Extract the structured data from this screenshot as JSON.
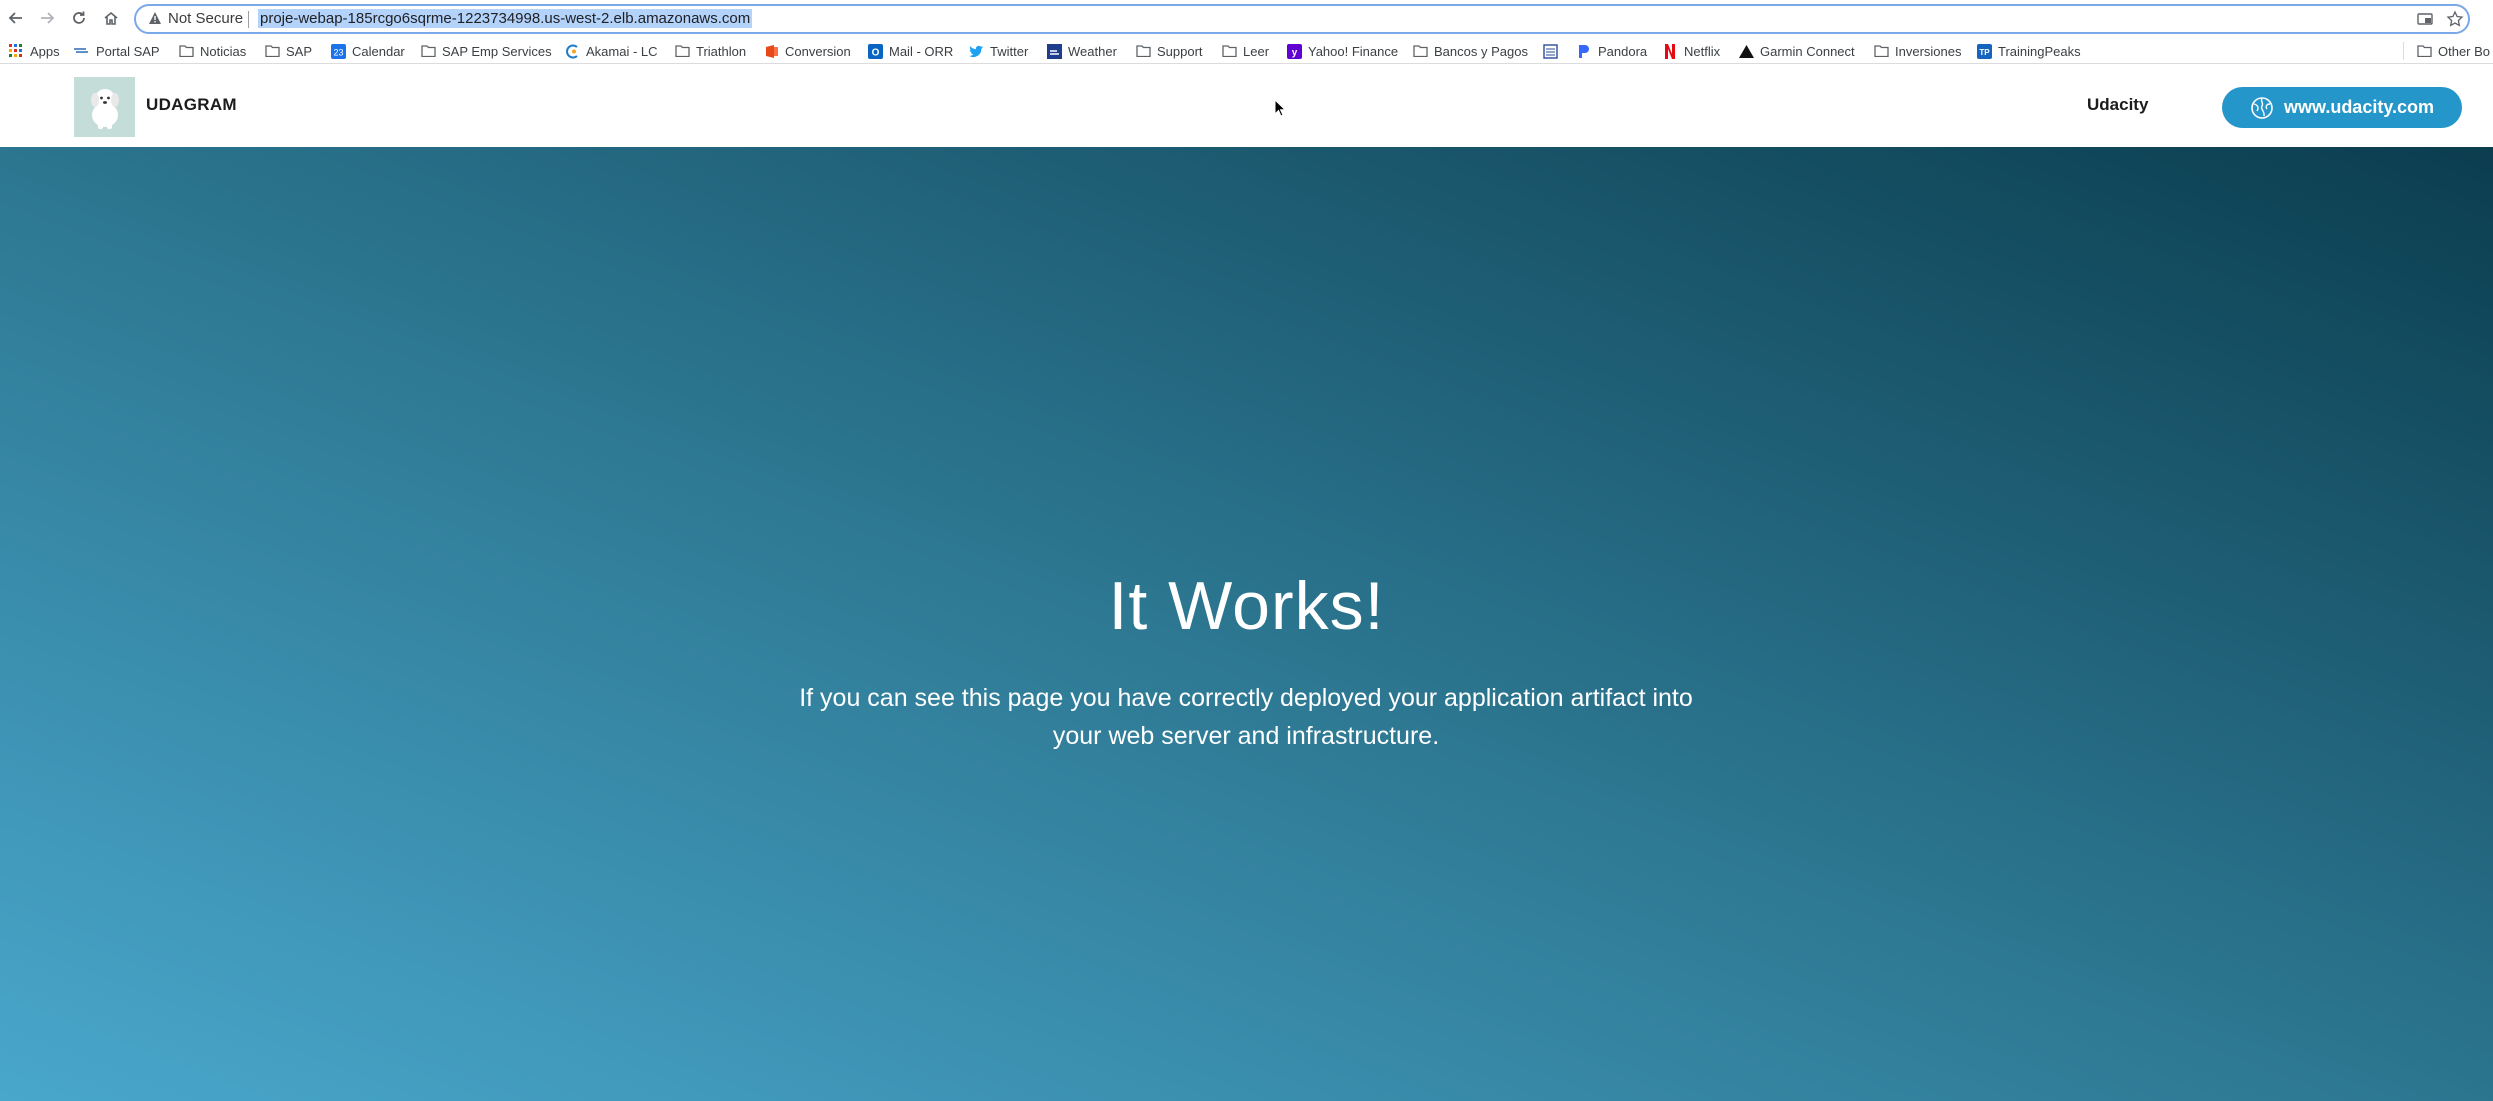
{
  "browser": {
    "security_label": "Not Secure",
    "url": "proje-webap-185rcgo6sqrme-1223734998.us-west-2.elb.amazonaws.com"
  },
  "bookmarks": {
    "items": [
      {
        "label": "Apps",
        "icon": "apps-grid-icon"
      },
      {
        "label": "Portal SAP",
        "icon": "sap-portal-icon"
      },
      {
        "label": "Noticias",
        "icon": "folder-icon"
      },
      {
        "label": "SAP",
        "icon": "folder-icon"
      },
      {
        "label": "Calendar",
        "icon": "calendar-icon"
      },
      {
        "label": "SAP Emp Services",
        "icon": "folder-icon"
      },
      {
        "label": "Akamai - LC",
        "icon": "akamai-icon"
      },
      {
        "label": "Triathlon",
        "icon": "folder-icon"
      },
      {
        "label": "Conversion",
        "icon": "office-icon"
      },
      {
        "label": "Mail - ORR",
        "icon": "outlook-icon"
      },
      {
        "label": "Twitter",
        "icon": "twitter-icon"
      },
      {
        "label": "Weather",
        "icon": "weather-icon"
      },
      {
        "label": "Support",
        "icon": "folder-icon"
      },
      {
        "label": "Leer",
        "icon": "folder-icon"
      },
      {
        "label": "Yahoo! Finance",
        "icon": "yahoo-icon"
      },
      {
        "label": "Bancos y Pagos",
        "icon": "folder-icon"
      },
      {
        "label": "",
        "icon": "site-favicon-icon"
      },
      {
        "label": "Pandora",
        "icon": "pandora-icon"
      },
      {
        "label": "Netflix",
        "icon": "netflix-icon"
      },
      {
        "label": "Garmin Connect",
        "icon": "garmin-icon"
      },
      {
        "label": "Inversiones",
        "icon": "folder-icon"
      },
      {
        "label": "TrainingPeaks",
        "icon": "trainingpeaks-icon"
      }
    ],
    "other_label": "Other Bo"
  },
  "header": {
    "brand": "UDAGRAM",
    "nav_link": "Udacity",
    "cta_label": "www.udacity.com"
  },
  "hero": {
    "title": "It Works!",
    "text": "If you can see this page you have correctly deployed your application artifact into your web server and infrastructure."
  },
  "colors": {
    "cta": "#2596c9",
    "hero_gradient_start": "#49a7cc",
    "hero_gradient_end": "#0b3d4f"
  }
}
